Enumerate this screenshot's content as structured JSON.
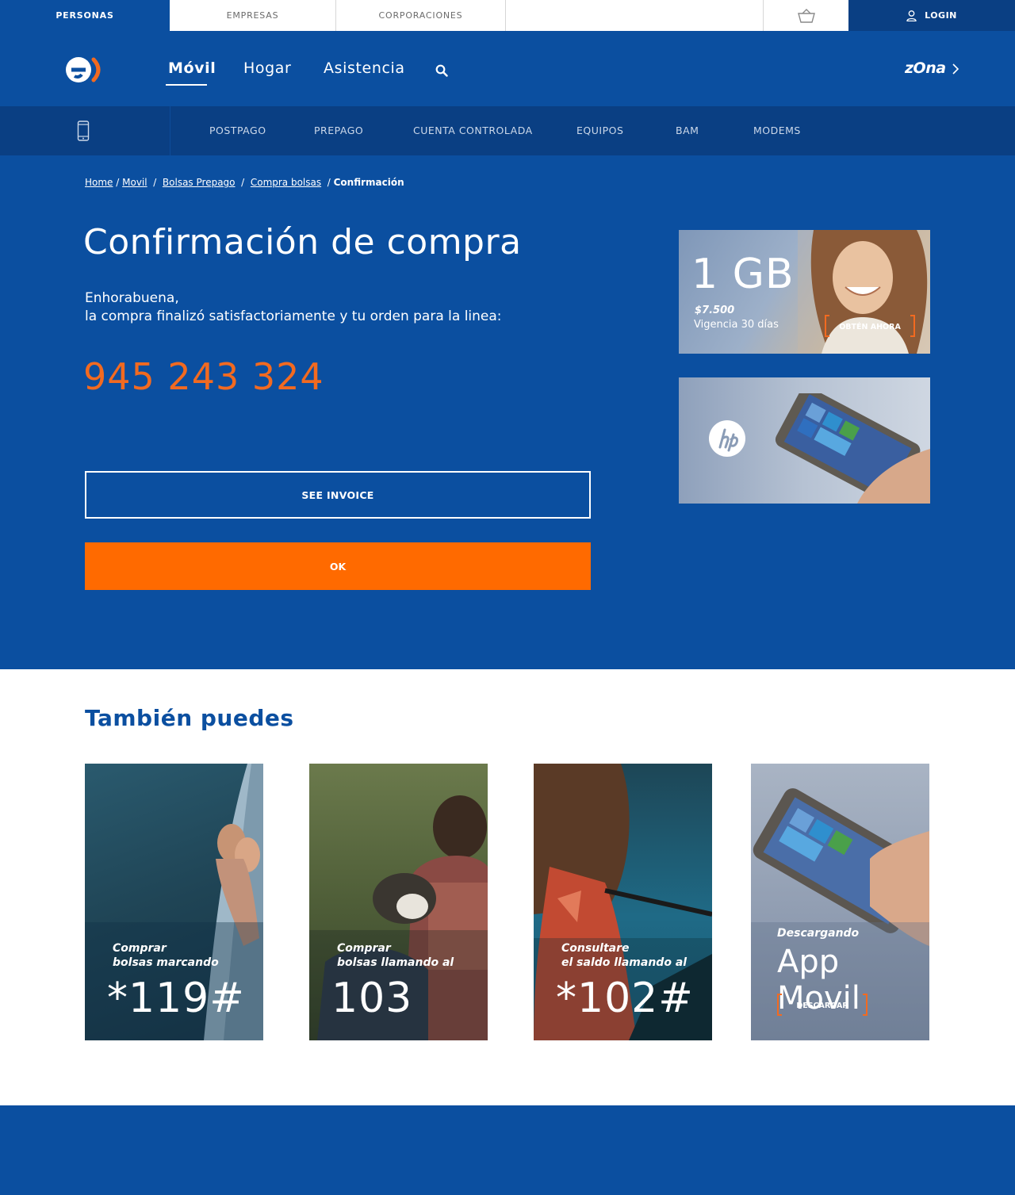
{
  "topbar": {
    "tabs": [
      "PERSONAS",
      "EMPRESAS",
      "CORPORACIONES"
    ],
    "login": "LOGIN"
  },
  "header": {
    "nav": [
      "Móvil",
      "Hogar",
      "Asistencia"
    ],
    "zona": "zOna"
  },
  "subnav": {
    "items": [
      "POSTPAGO",
      "PREPAGO",
      "CUENTA CONTROLADA",
      "EQUIPOS",
      "BAM",
      "MODEMS"
    ]
  },
  "breadcrumb": {
    "items": [
      "Home",
      "Movil",
      "Bolsas Prepago",
      "Compra bolsas"
    ],
    "current": "Confirmación"
  },
  "confirmation": {
    "title": "Confirmación de compra",
    "line1": "Enhorabuena,",
    "line2": "la compra finalizó satisfactoriamente y tu orden para la linea:",
    "phone": "945 243 324",
    "see_invoice": "SEE INVOICE",
    "ok": "OK"
  },
  "promo": {
    "gb": "1 GB",
    "price": "$7.500",
    "validity": "Vigencia 30 días",
    "cta": "OBTÉN AHORA"
  },
  "also": {
    "title": "También puedes",
    "cards": [
      {
        "line1": "Comprar",
        "line2": "bolsas marcando",
        "big": "*119#"
      },
      {
        "line1": "Comprar",
        "line2": "bolsas llamando al",
        "big": "103"
      },
      {
        "line1": "Consultare",
        "line2": "el saldo llamando al",
        "big": "*102#"
      }
    ],
    "app": {
      "caption": "Descargando",
      "title": "App Movil",
      "cta": "DESCARGAR"
    }
  },
  "colors": {
    "brand_blue": "#0b4fa0",
    "dark_blue": "#0a3f83",
    "accent_orange": "#ff6a00"
  }
}
